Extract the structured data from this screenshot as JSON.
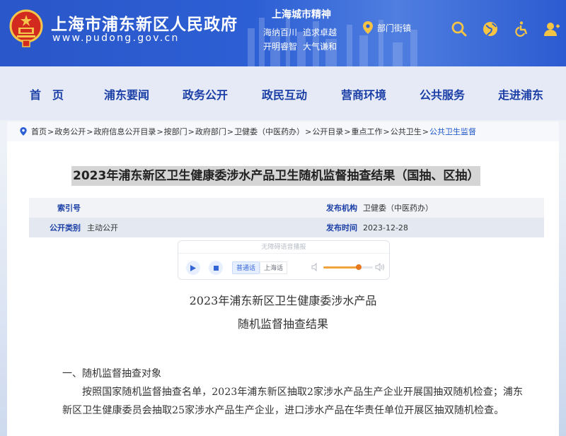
{
  "header": {
    "site_title": "上海市浦东新区人民政府",
    "site_url": "www.pudong.gov.cn",
    "spirit_title": "上海城市精神",
    "spirit_line1": [
      "海纳百川",
      "追求卓越"
    ],
    "spirit_line2": [
      "开明睿智",
      "大气谦和"
    ],
    "dept_link": "部门街镇",
    "icons": [
      "search-icon",
      "globe-icon",
      "accessibility-icon",
      "user-icon"
    ]
  },
  "nav": {
    "items": [
      "首　页",
      "浦东要闻",
      "政务公开",
      "政民互动",
      "营商环境",
      "公共服务",
      "走进浦东"
    ]
  },
  "breadcrumb": {
    "items": [
      "首页",
      "政务公开",
      "政府信息公开目录",
      "按部门",
      "政府部门",
      "卫健委（中医药办）",
      "公开目录",
      "重点工作",
      "公共卫生",
      "公共卫生监督"
    ]
  },
  "article": {
    "title": "2023年浦东新区卫生健康委涉水产品卫生随机监督抽查结果（国抽、区抽）",
    "meta": {
      "index_label": "索引号",
      "index_value": "",
      "publisher_label": "发布机构",
      "publisher_value": "卫健委（中医药办）",
      "category_label": "公开类别",
      "category_value": "主动公开",
      "date_label": "发布时间",
      "date_value": "2023-12-28"
    },
    "doc_title_line1": "2023年浦东新区卫生健康委涉水产品",
    "doc_title_line2": "随机监督抽查结果",
    "section1_heading": "一、随机监督抽查对象",
    "section1_para": "按照国家随机监督抽查名单，2023年浦东新区抽取2家涉水产品生产企业开展国抽双随机检查；浦东新区卫生健康委员会抽取25家涉水产品生产企业，进口涉水产品在华责任单位开展区抽双随机检查。"
  },
  "player": {
    "header": "无障碍语音播报",
    "lang_active": "普通话",
    "lang_other": "上海话",
    "volume_level": 0.72
  },
  "colors": {
    "brand_blue": "#2d5fd4",
    "nav_text": "#1b3fa6",
    "emblem_red": "#d22a1e",
    "emblem_gold": "#f4c54a",
    "highlight": "#d5d5d5",
    "volume_orange": "#f0a43b"
  }
}
